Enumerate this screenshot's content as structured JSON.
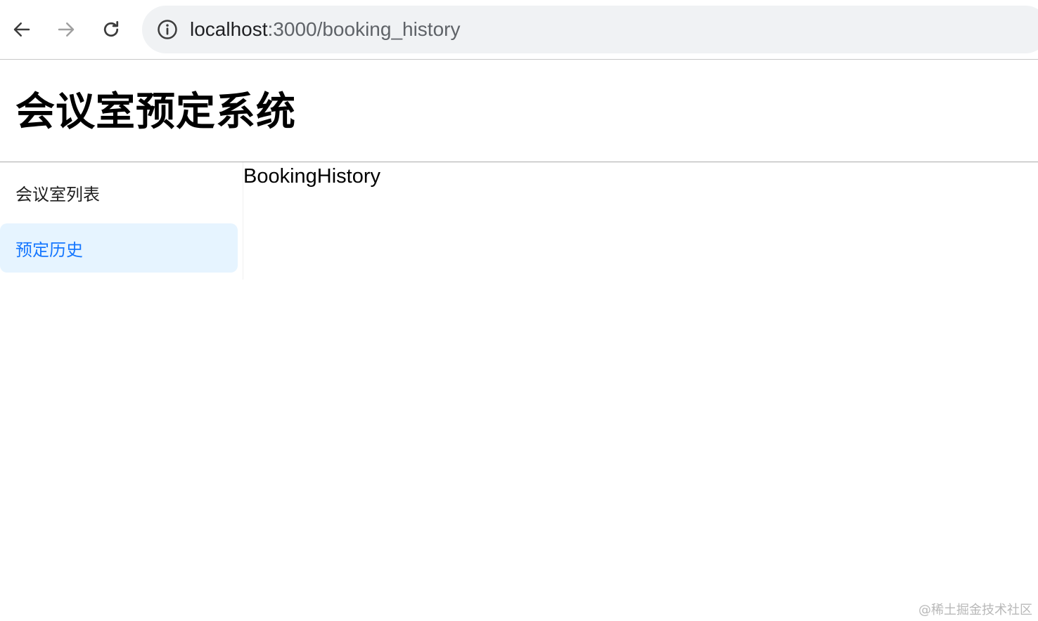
{
  "browser": {
    "url_host": "localhost",
    "url_path": ":3000/booking_history",
    "icons": [
      "back-arrow-icon",
      "forward-arrow-icon",
      "reload-icon",
      "info-icon"
    ],
    "colors": {
      "omnibox_bg": "#f0f2f4",
      "forward_disabled": "#a0a0a0"
    }
  },
  "header": {
    "title": "会议室预定系统"
  },
  "sidebar": {
    "items": [
      {
        "label": "会议室列表",
        "selected": false
      },
      {
        "label": "预定历史",
        "selected": true
      }
    ],
    "colors": {
      "selected_bg": "#e6f4ff",
      "selected_text": "#1677ff"
    }
  },
  "content": {
    "text": "BookingHistory"
  },
  "watermark": "@稀土掘金技术社区"
}
